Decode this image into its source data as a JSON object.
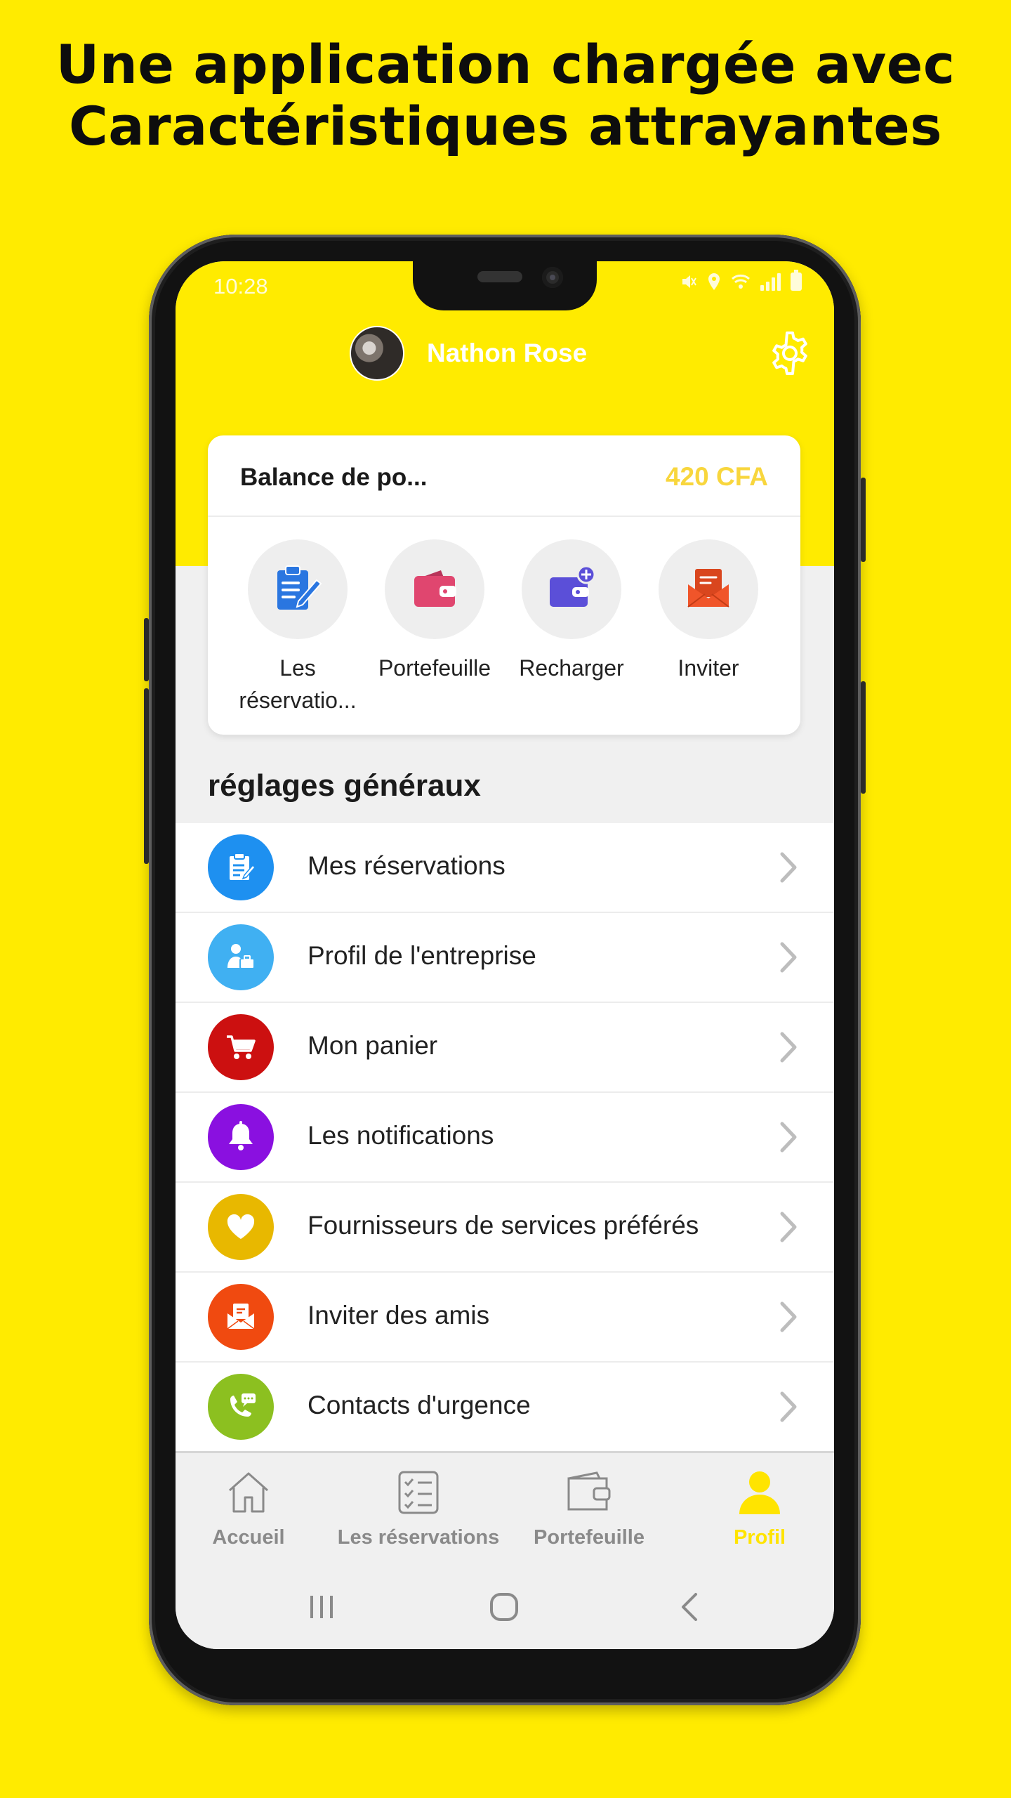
{
  "headline": {
    "line1": "Une application chargée avec",
    "line2": "Caractéristiques attrayantes"
  },
  "status_bar": {
    "time": "10:28"
  },
  "profile": {
    "name": "Nathon Rose"
  },
  "balance_card": {
    "title": "Balance de po...",
    "amount": "420 CFA",
    "actions": [
      {
        "icon": "reservations-clipboard-icon",
        "label": "Les réservatio..."
      },
      {
        "icon": "wallet-icon",
        "label": "Portefeuille"
      },
      {
        "icon": "wallet-plus-icon",
        "label": "Recharger"
      },
      {
        "icon": "envelope-icon",
        "label": "Inviter"
      }
    ]
  },
  "settings": {
    "title": "réglages généraux",
    "items": [
      {
        "label": "Mes réservations",
        "icon": "clipboard-icon",
        "color": "#1E90F0"
      },
      {
        "label": "Profil de l'entreprise",
        "icon": "business-profile-icon",
        "color": "#40B0F2"
      },
      {
        "label": "Mon panier",
        "icon": "cart-icon",
        "color": "#CC1010"
      },
      {
        "label": "Les notifications",
        "icon": "bell-icon",
        "color": "#8A10E0"
      },
      {
        "label": "Fournisseurs de services préférés",
        "icon": "heart-icon",
        "color": "#E8B800"
      },
      {
        "label": "Inviter des amis",
        "icon": "invite-envelope-icon",
        "color": "#F04A10"
      },
      {
        "label": "Contacts d'urgence",
        "icon": "phone-chat-icon",
        "color": "#8CC020"
      }
    ]
  },
  "tabbar": {
    "tabs": [
      {
        "label": "Accueil",
        "icon": "home-icon",
        "active": false
      },
      {
        "label": "Les réservations",
        "icon": "checklist-icon",
        "active": false
      },
      {
        "label": "Portefeuille",
        "icon": "wallet-icon",
        "active": false
      },
      {
        "label": "Profil",
        "icon": "person-icon",
        "active": true
      }
    ],
    "active_color": "#FFE400"
  },
  "colors": {
    "background": "#FFEB00",
    "accent": "#FFEB00",
    "balance": "#F8D63D"
  }
}
